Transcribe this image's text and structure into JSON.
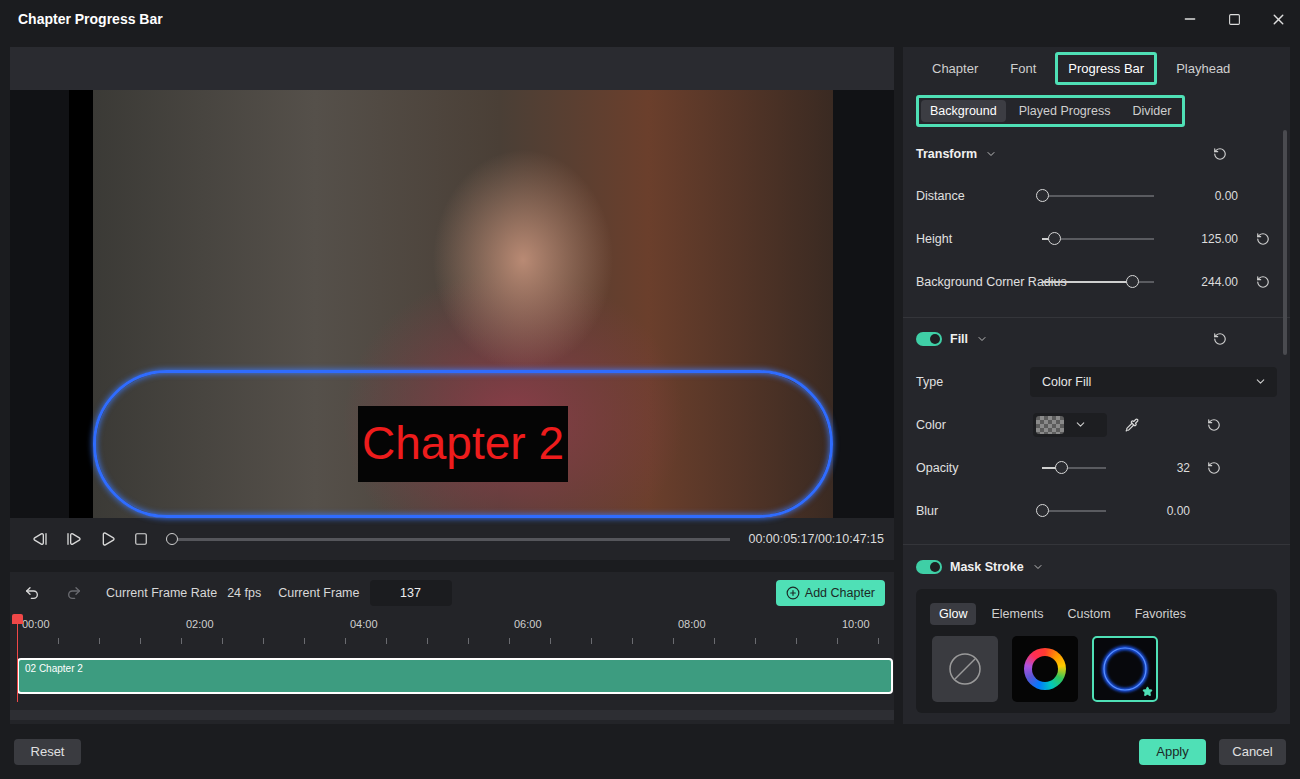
{
  "window": {
    "title": "Chapter Progress Bar"
  },
  "preview": {
    "overlay_label": "Chapter 2"
  },
  "player": {
    "time": "00:00:05:17/00:10:47:15",
    "level": 0.01
  },
  "timeline_toolbar": {
    "frame_rate_label": "Current Frame Rate",
    "frame_rate": "24 fps",
    "frame_label": "Current Frame",
    "frame": "137",
    "add_button": "Add Chapter"
  },
  "ruler": [
    "00:00",
    "02:00",
    "04:00",
    "06:00",
    "08:00",
    "10:00"
  ],
  "clips": [
    {
      "label": "02 Chapter 2",
      "selected": true
    }
  ],
  "tabs": [
    {
      "label": "Chapter",
      "selected": false
    },
    {
      "label": "Font",
      "selected": false
    },
    {
      "label": "Progress Bar",
      "selected": true
    },
    {
      "label": "Playhead",
      "selected": false
    }
  ],
  "subtabs": [
    {
      "label": "Background",
      "selected": true
    },
    {
      "label": "Played Progress",
      "selected": false
    },
    {
      "label": "Divider",
      "selected": false
    }
  ],
  "transform": {
    "title": "Transform",
    "expanded": true,
    "rows": [
      {
        "label": "Distance",
        "level": 0,
        "value": "0.00",
        "reset": false
      },
      {
        "label": "Height",
        "level": 0.11,
        "value": "125.00",
        "reset": true
      },
      {
        "label": "Background Corner Radius",
        "level": 0.8,
        "value": "244.00",
        "reset": true
      }
    ]
  },
  "fill": {
    "title": "Fill",
    "on": true,
    "expanded": true,
    "type_label": "Type",
    "type": "Color Fill",
    "color_label": "Color",
    "rows": [
      {
        "label": "Opacity",
        "level": 0.3,
        "value": "32",
        "reset": true
      },
      {
        "label": "Blur",
        "level": 0,
        "value": "0.00",
        "reset": false
      }
    ]
  },
  "mask_stroke": {
    "title": "Mask Stroke",
    "on": true,
    "expanded": true,
    "tabs": [
      {
        "label": "Glow",
        "selected": true
      },
      {
        "label": "Elements",
        "selected": false
      },
      {
        "label": "Custom",
        "selected": false
      },
      {
        "label": "Favorites",
        "selected": false
      }
    ],
    "presets": [
      {
        "kind": "none",
        "selected": false
      },
      {
        "kind": "wheel",
        "selected": false
      },
      {
        "kind": "arc",
        "selected": true
      }
    ]
  },
  "buttons": {
    "reset": "Reset",
    "apply": "Apply",
    "cancel": "Cancel"
  }
}
